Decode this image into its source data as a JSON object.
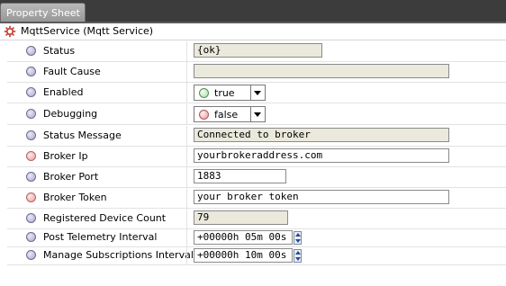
{
  "tab": {
    "label": "Property Sheet"
  },
  "header": {
    "title": "MqttService  (Mqtt Service)"
  },
  "rows": [
    {
      "label": "Status",
      "value": "{ok}"
    },
    {
      "label": "Fault Cause",
      "value": ""
    },
    {
      "label": "Enabled",
      "value": "true"
    },
    {
      "label": "Debugging",
      "value": "false"
    },
    {
      "label": "Status Message",
      "value": "Connected to broker"
    },
    {
      "label": "Broker Ip",
      "value": "yourbrokeraddress.com"
    },
    {
      "label": "Broker Port",
      "value": "1883"
    },
    {
      "label": "Broker Token",
      "value": "your broker token"
    },
    {
      "label": "Registered Device Count",
      "value": "79"
    },
    {
      "label": "Post Telemetry Interval",
      "value": "+00000h 05m 00s"
    },
    {
      "label": "Manage Subscriptions Interval",
      "value": "+00000h 10m 00s"
    }
  ],
  "colors": {
    "readonly_field_bg": "#eae9dc",
    "tabbar_bg": "#3c3c3c",
    "status_dot_normal": "#a8a8cc",
    "status_dot_highlight": "#e8a0a0"
  }
}
